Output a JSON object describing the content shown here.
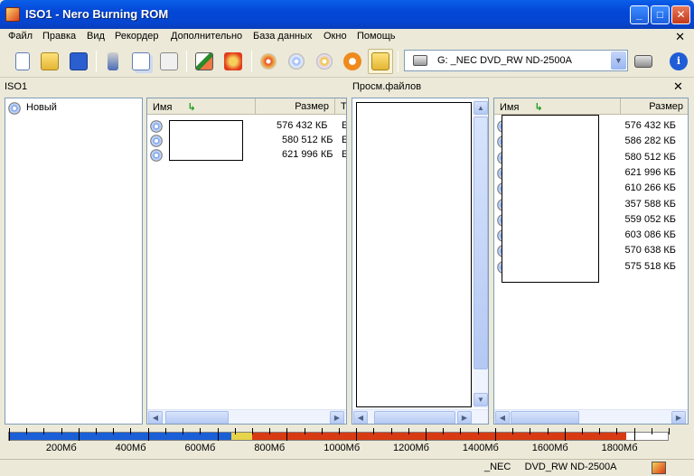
{
  "window": {
    "title": "ISO1 - Nero Burning ROM",
    "min": "_",
    "max": "□",
    "close": "✕"
  },
  "menu": [
    "Файл",
    "Правка",
    "Вид",
    "Рекордер",
    "Дополнительно",
    "База данных",
    "Окно",
    "Помощь"
  ],
  "menu_close": "✕",
  "drive": {
    "label": "G:  _NEC DVD_RW ND-2500A"
  },
  "project": {
    "name": "ISO1",
    "browser_title": "Просм.файлов",
    "browser_close": "✕"
  },
  "tree": {
    "item": "Новый"
  },
  "left_list": {
    "col_name": "Имя",
    "col_size": "Размер",
    "col_type": "Т",
    "rows": [
      {
        "size": "576 432 КБ",
        "type": "E"
      },
      {
        "size": "580 512 КБ",
        "type": "E"
      },
      {
        "size": "621 996 КБ",
        "type": "E"
      }
    ]
  },
  "right_list": {
    "col_name": "Имя",
    "col_size": "Размер",
    "rows": [
      "576 432 КБ",
      "586 282 КБ",
      "580 512 КБ",
      "621 996 КБ",
      "610 266 КБ",
      "357 588 КБ",
      "559 052 КБ",
      "603 086 КБ",
      "570 638 КБ",
      "575 518 КБ"
    ]
  },
  "capacity": {
    "labels": [
      "200Мб",
      "400Мб",
      "600Мб",
      "800Мб",
      "1000Мб",
      "1200Мб",
      "1400Мб",
      "1600Мб",
      "1800Мб"
    ],
    "used_mb": 1778,
    "blue_mb": 640,
    "yellow_mb": 700,
    "max_mb": 1900,
    "colors": {
      "blue": "#1a5fd6",
      "yellow": "#e8d44a",
      "red": "#d83a12"
    }
  },
  "status": {
    "drive": "_NEC     DVD_RW ND-2500A"
  }
}
